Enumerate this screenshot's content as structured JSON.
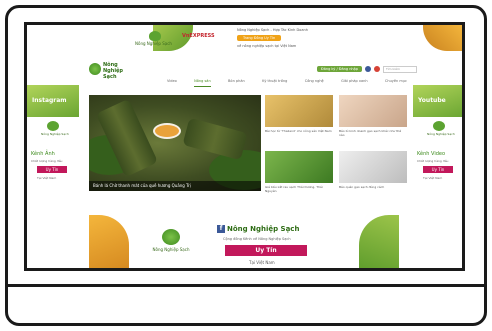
{
  "top_banner": {
    "brand": "Nông Nghiệp Sạch",
    "partner": "VnEXPRESS",
    "line1": "Nông Nghiệp Sạch - Hợp Tác Kinh Doanh",
    "cta": "Trang Đông Uy Tín",
    "line2": "về nông nghiệp sạch tại Việt Nam"
  },
  "header": {
    "logo_text": "Nông Nghiệp Sạch",
    "login_label": "Đăng ký / Đăng nhập",
    "search_placeholder": "Tìm kiếm"
  },
  "nav": {
    "items": [
      "Video",
      "Nông sản",
      "Bón phân",
      "Kỹ thuật trồng",
      "Công nghệ",
      "Giải pháp xanh",
      "Chuyên mục"
    ],
    "active_index": 1
  },
  "side_left": {
    "label": "Instagram",
    "brand": "Nông Nghiệp Sạch",
    "sub": "Kênh Ảnh",
    "sub2": "Chất lượng hàng đầu",
    "cta": "Uy Tín",
    "foot": "Tại Việt Nam"
  },
  "side_right": {
    "label": "Youtube",
    "brand": "Nông Nghiệp Sạch",
    "sub": "Kênh Video",
    "sub2": "Chất lượng hàng đầu",
    "cta": "Uy Tín",
    "foot": "Tại Việt Nam"
  },
  "hero": {
    "caption": "Bánh lá Chờ thanh mát của quê hương Quảng Trị"
  },
  "articles": [
    {
      "caption": "Bài học từ ‘Thailand’ cho nông sản Việt Nam"
    },
    {
      "caption": "Bảo bì kinh doanh gạo sạch khác như thế nào"
    },
    {
      "caption": "Giá bấu xắt rau sạch Thái Dương, Thái Nguyên"
    },
    {
      "caption": "Bảo quản gạo sạch đúng cách"
    }
  ],
  "bottom_banner": {
    "title": "Nông Nghiệp Sạch",
    "sub": "Cộng đồng Kênh về Nông Nghiệp Sạch",
    "cta": "Uy Tín",
    "foot": "Tại Việt Nam"
  }
}
